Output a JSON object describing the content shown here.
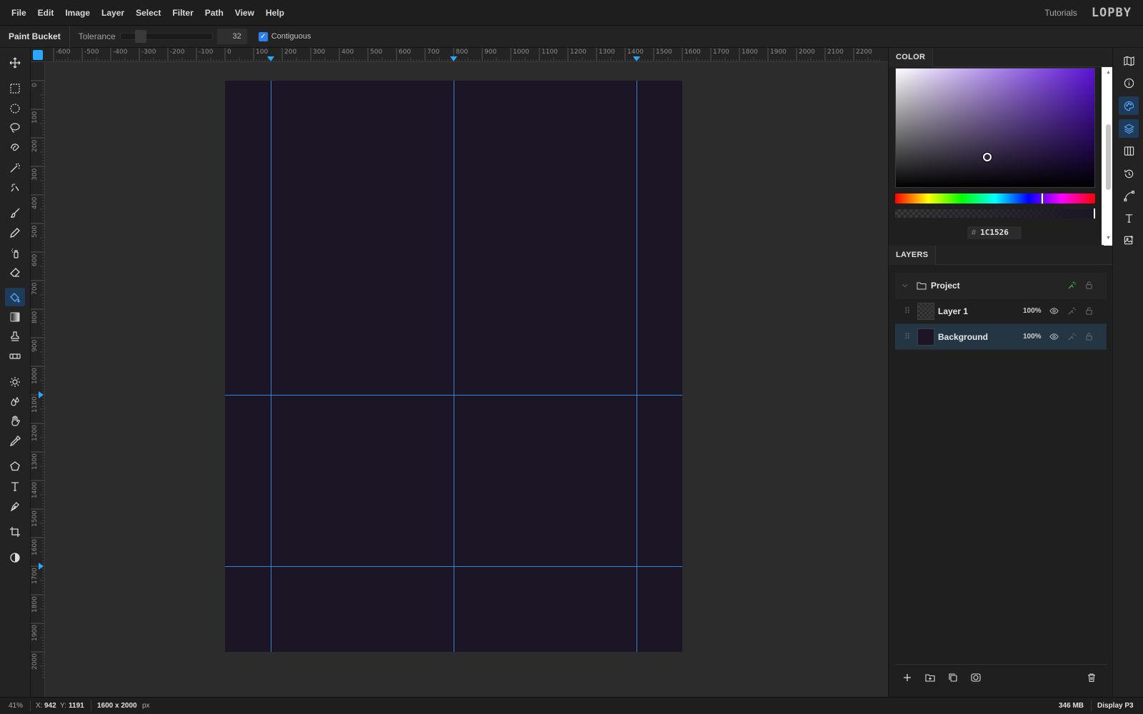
{
  "menu": [
    "File",
    "Edit",
    "Image",
    "Layer",
    "Select",
    "Filter",
    "Path",
    "View",
    "Help"
  ],
  "header": {
    "tutorials": "Tutorials",
    "logo": "LOPBY"
  },
  "options": {
    "tool_name": "Paint Bucket",
    "tolerance_label": "Tolerance",
    "tolerance_value": "32",
    "tolerance_fraction": 0.18,
    "contiguous_label": "Contiguous",
    "contiguous_checked": true
  },
  "rulers": {
    "top_labels": [
      "-600",
      "-500",
      "-400",
      "-300",
      "-200",
      "-100",
      "0",
      "100",
      "200",
      "300",
      "400",
      "500",
      "600",
      "700",
      "800",
      "900",
      "1000",
      "1100",
      "1200",
      "1300",
      "1400",
      "1500",
      "1600",
      "1700",
      "1800",
      "1900",
      "2000",
      "2100",
      "2200"
    ],
    "left_labels": [
      "0",
      "100",
      "200",
      "300",
      "400",
      "500",
      "600",
      "700",
      "800",
      "900",
      "1000",
      "1100",
      "1200",
      "1300",
      "1400",
      "1500",
      "1600",
      "1700",
      "1800",
      "1900",
      "2000"
    ]
  },
  "document": {
    "width": 1600,
    "height": 2000,
    "background": "#1C1526",
    "guides_x": [
      160,
      800,
      1440
    ],
    "guides_y": [
      1100,
      1700
    ]
  },
  "color_panel": {
    "title": "COLOR",
    "hex_prefix": "#",
    "hex": "1C1526"
  },
  "layers_panel": {
    "title": "LAYERS",
    "group": {
      "name": "Project"
    },
    "layers": [
      {
        "name": "Layer 1",
        "opacity": "100%",
        "thumb": "transparent",
        "selected": false
      },
      {
        "name": "Background",
        "opacity": "100%",
        "thumb": "filled",
        "selected": true
      }
    ]
  },
  "status": {
    "zoom": "41%",
    "x_label": "X:",
    "x": "942",
    "y_label": "Y:",
    "y": "1191",
    "doc_size": "1600 x 2000",
    "doc_unit": "px",
    "memory": "346 MB",
    "color_profile": "Display P3"
  },
  "colors": {
    "accent": "#2aa7ff",
    "guide": "#2a87d8",
    "canvas": "#1c1526"
  }
}
